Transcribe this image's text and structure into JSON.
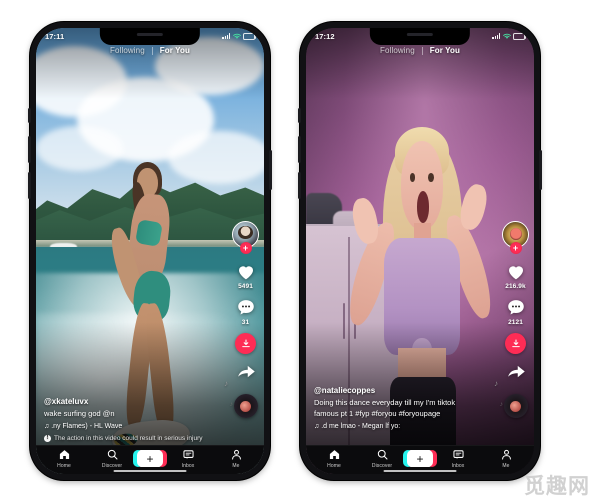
{
  "watermark": "觅趣网",
  "phones": [
    {
      "id": "left",
      "status": {
        "time": "17:11",
        "signal_bars": 4,
        "wifi": true,
        "battery_pct": 78
      },
      "tabs": {
        "following": "Following",
        "for_you": "For You",
        "active": "For You"
      },
      "rail": {
        "avatar_name": "profile-avatar",
        "follow_badge": "+",
        "like_count": "5491",
        "comment_count": "31",
        "download_label": "download-icon",
        "share_label": "share-icon"
      },
      "caption": {
        "handle": "@xkateluvx",
        "description": "wake surfing god @n",
        "music": "♫  .ny Flames) - HL Wave"
      },
      "warning": {
        "icon": "!",
        "text": "The action in this video could result in serious injury"
      },
      "nav": [
        {
          "icon": "home-icon",
          "label": "Home"
        },
        {
          "icon": "search-icon",
          "label": "Discover"
        },
        {
          "icon": "plus-icon",
          "label": ""
        },
        {
          "icon": "inbox-icon",
          "label": "Inbox"
        },
        {
          "icon": "person-icon",
          "label": "Me"
        }
      ]
    },
    {
      "id": "right",
      "status": {
        "time": "17:12",
        "signal_bars": 4,
        "wifi": true,
        "battery_pct": 72
      },
      "tabs": {
        "following": "Following",
        "for_you": "For You",
        "active": "For You"
      },
      "rail": {
        "avatar_name": "profile-avatar",
        "follow_badge": "+",
        "like_count": "216.9k",
        "comment_count": "2121",
        "download_label": "download-icon",
        "share_label": "share-icon"
      },
      "caption": {
        "handle": "@nataliecoppes",
        "description": "Doing this dance everyday till my I'm tiktok famous pt 1 #fyp #foryou #foryoupage",
        "music": "♫  .d me lmao - Megan   lf yo:"
      },
      "nav": [
        {
          "icon": "home-icon",
          "label": "Home"
        },
        {
          "icon": "search-icon",
          "label": "Discover"
        },
        {
          "icon": "plus-icon",
          "label": ""
        },
        {
          "icon": "inbox-icon",
          "label": "Inbox"
        },
        {
          "icon": "person-icon",
          "label": "Me"
        }
      ]
    }
  ],
  "colors": {
    "accent_pink": "#fe2c55",
    "accent_cyan": "#25f4ee",
    "nav_bg": "#0b0b0d",
    "frame": "#111114"
  }
}
